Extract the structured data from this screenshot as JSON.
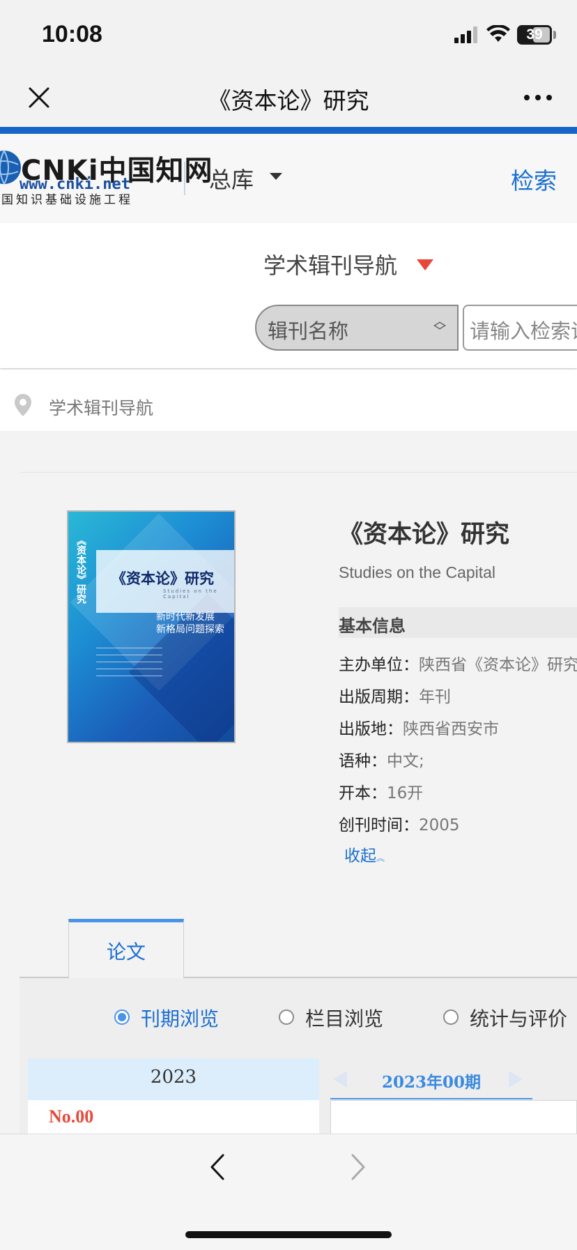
{
  "status_bar": {
    "time": "10:08",
    "battery": "39"
  },
  "header": {
    "title": "《资本论》研究",
    "close_icon": "close-icon",
    "more_icon": "more-dots-icon"
  },
  "cnki": {
    "logo_text": "CNKi中国知网",
    "logo_url": "www.cnki.net",
    "logo_subtitle": "国知识基础设施工程",
    "library": "总库",
    "search_link": "检索"
  },
  "nav": {
    "heading": "学术辑刊导航",
    "field_select": "辑刊名称",
    "search_placeholder": "请输入检索词"
  },
  "breadcrumb": {
    "text": "学术辑刊导航"
  },
  "journal": {
    "title": "《资本论》研究",
    "title_en": "Studies on the Capital",
    "info_heading": "基本信息",
    "info": [
      {
        "label": "主办单位：",
        "value": "陕西省《资本论》研究会"
      },
      {
        "label": "出版周期：",
        "value": "年刊"
      },
      {
        "label": "出版地：",
        "value": "陕西省西安市"
      },
      {
        "label": "语种：",
        "value": "中文;"
      },
      {
        "label": "开本：",
        "value": "16开"
      },
      {
        "label": "创刊时间：",
        "value": "2005"
      }
    ],
    "collapse": "收起"
  },
  "cover": {
    "title": "《资本论》研究",
    "vertical_title": "《资本论》研究",
    "theme_line1": "新时代新发展",
    "theme_line2": "新格局问题探索",
    "subtitle_en": "Studies on the Capital"
  },
  "tabs": [
    {
      "label": "论文",
      "active": true
    }
  ],
  "browse_options": [
    {
      "label": "刊期浏览",
      "selected": true
    },
    {
      "label": "栏目浏览",
      "selected": false
    },
    {
      "label": "统计与评价",
      "selected": false
    }
  ],
  "years": [
    {
      "year": "2023",
      "issues": [
        "No.00"
      ]
    }
  ],
  "period": {
    "label": "2023年00期"
  },
  "colors": {
    "accent": "#1565c8",
    "link": "#1a6fd1",
    "issue": "#e64a3a",
    "arrow": "#e8463a"
  },
  "toolbar": {
    "back_icon": "chevron-left-icon",
    "forward_icon": "chevron-right-icon"
  }
}
